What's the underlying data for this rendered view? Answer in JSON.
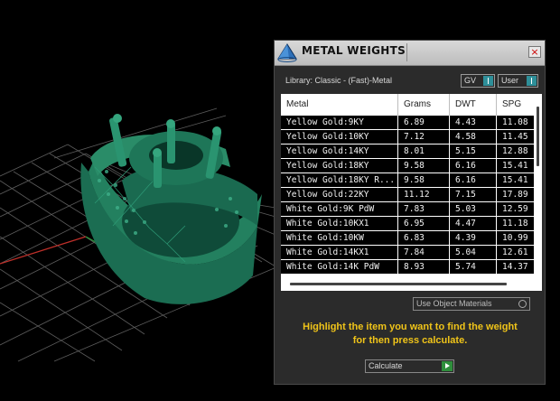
{
  "panel": {
    "title": "METAL WEIGHTS",
    "close_symbol": "×",
    "library_label": "Library: Classic - (Fast)-Metal",
    "gv_toggle": "GV",
    "user_toggle": "User",
    "use_object_materials": "Use Object Materials",
    "instructions_line1": "Highlight the item you want to find the weight",
    "instructions_line2": "for then press calculate.",
    "calculate_label": "Calculate"
  },
  "table": {
    "columns": [
      "Metal",
      "Grams",
      "DWT",
      "SPG"
    ],
    "rows": [
      [
        "Yellow Gold:9KY",
        "6.89",
        "4.43",
        "11.08"
      ],
      [
        "Yellow Gold:10KY",
        "7.12",
        "4.58",
        "11.45"
      ],
      [
        "Yellow Gold:14KY",
        "8.01",
        "5.15",
        "12.88"
      ],
      [
        "Yellow Gold:18KY",
        "9.58",
        "6.16",
        "15.41"
      ],
      [
        "Yellow Gold:18KY R...",
        "9.58",
        "6.16",
        "15.41"
      ],
      [
        "Yellow Gold:22KY",
        "11.12",
        "7.15",
        "17.89"
      ],
      [
        "White Gold:9K PdW",
        "7.83",
        "5.03",
        "12.59"
      ],
      [
        "White Gold:10KX1",
        "6.95",
        "4.47",
        "11.18"
      ],
      [
        "White Gold:10KW",
        "6.83",
        "4.39",
        "10.99"
      ],
      [
        "White Gold:14KX1",
        "7.84",
        "5.04",
        "12.61"
      ],
      [
        "White Gold:14K PdW",
        "8.93",
        "5.74",
        "14.37"
      ]
    ]
  },
  "colors": {
    "viewport_bg": "#000000",
    "grid": "#5a5a5a",
    "ring": "#1f7a5c",
    "instructions": "#f0c419",
    "toggle_knob": "#2e8f99",
    "calculate_go": "#2f8f3c"
  },
  "icons": {
    "logo": "pyramid-logo-icon",
    "close": "close-icon",
    "calculate": "play-arrow-icon"
  }
}
